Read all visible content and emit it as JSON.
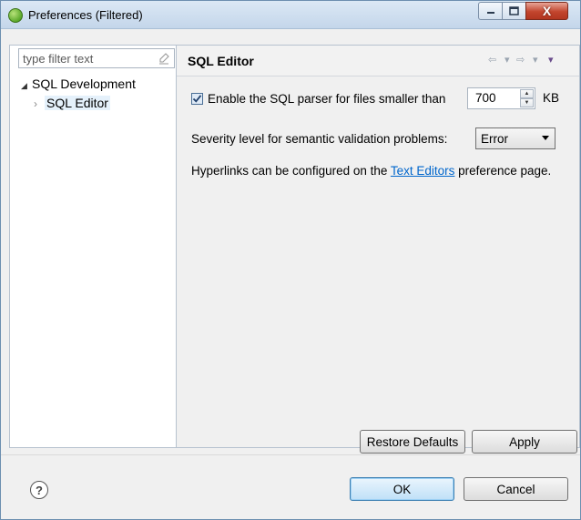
{
  "window": {
    "title": "Preferences (Filtered)",
    "close_glyph": "X"
  },
  "tree": {
    "filter_placeholder": "type filter text",
    "root_label": "SQL Development",
    "child_label": "SQL Editor"
  },
  "page": {
    "title": "SQL Editor",
    "parser_checkbox_label": "Enable the SQL parser for files smaller than",
    "parser_checked": true,
    "parser_size_value": "700",
    "parser_size_unit": "KB",
    "severity_label": "Severity level for semantic validation problems:",
    "severity_value": "Error",
    "hyperlinks_prefix": "Hyperlinks can be configured on the ",
    "hyperlinks_link": "Text Editors",
    "hyperlinks_suffix": " preference page.",
    "restore_defaults_label": "Restore Defaults",
    "apply_label": "Apply"
  },
  "footer": {
    "help_glyph": "?",
    "ok_label": "OK",
    "cancel_label": "Cancel"
  },
  "colors": {
    "link": "#0066cc",
    "close_button": "#c2452d",
    "selection": "#e5f1fb"
  },
  "icons": [
    "app-logo-icon",
    "minimize-icon",
    "maximize-icon",
    "close-icon",
    "clear-filter-icon",
    "tree-expanded-icon",
    "tree-collapsed-icon",
    "back-arrow-icon",
    "forward-arrow-icon",
    "view-menu-icon",
    "help-icon",
    "checkbox-checked-icon"
  ]
}
